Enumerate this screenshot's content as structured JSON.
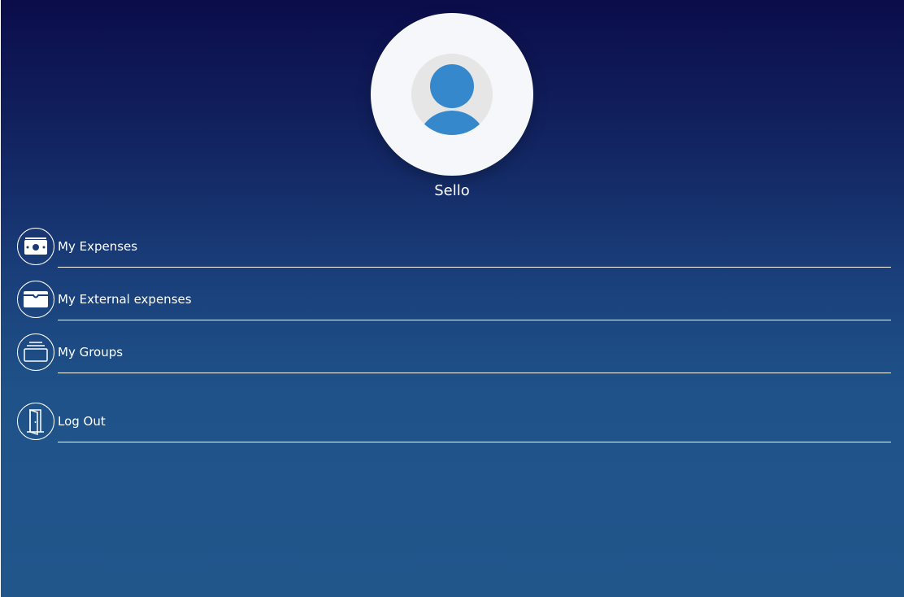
{
  "profile": {
    "user_name": "Sello",
    "avatar_icon": "user-avatar-icon"
  },
  "menu": {
    "items": [
      {
        "label": "My Expenses",
        "icon": "money-bill-icon"
      },
      {
        "label": "My External expenses",
        "icon": "wallet-icon"
      },
      {
        "label": "My Groups",
        "icon": "stacked-folders-icon"
      },
      {
        "label": "Log Out",
        "icon": "door-icon"
      }
    ]
  },
  "colors": {
    "background_top": "#0b0c4a",
    "background_bottom": "#21568b",
    "avatar_blue": "#3588cc",
    "profile_circle": "#f5f7fa"
  }
}
